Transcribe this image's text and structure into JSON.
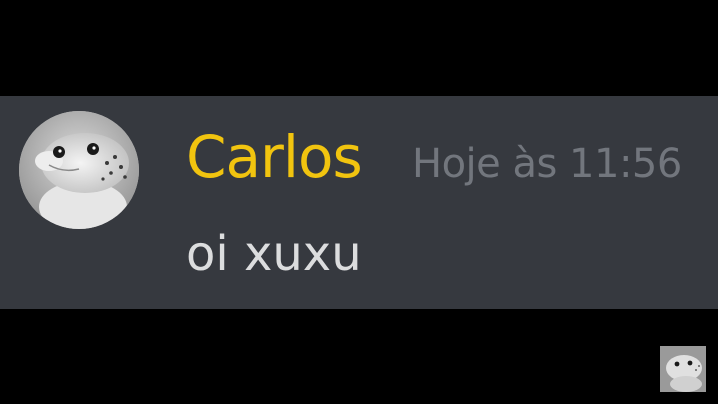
{
  "message": {
    "author": "Carlos",
    "author_color": "#f1c40f",
    "timestamp": "Hoje às 11:56",
    "text": "oi xuxu"
  },
  "avatar": {
    "icon": "gecko-avatar-icon"
  },
  "theme": {
    "panel_bg": "#36393f",
    "timestamp_color": "#72767d",
    "text_color": "#dcddde"
  }
}
